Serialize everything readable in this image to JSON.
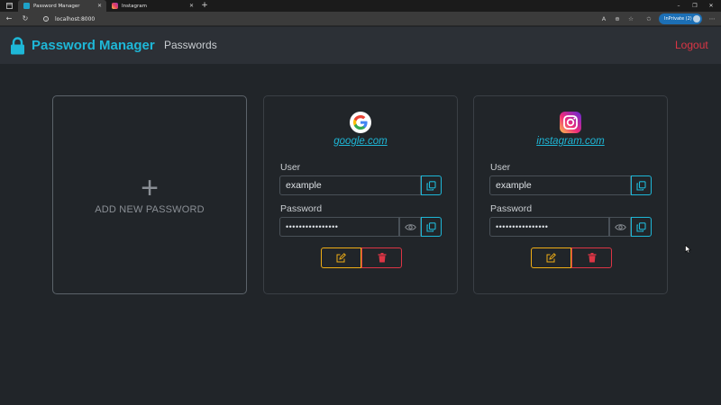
{
  "browser": {
    "tabs": [
      {
        "title": "Password Manager",
        "favicon": "lock-icon",
        "active": true
      },
      {
        "title": "Instagram",
        "favicon": "instagram-icon",
        "active": false
      }
    ],
    "new_tab": "+",
    "url": "localhost:8000",
    "inprivate_label": "InPrivate (2)",
    "window_controls": [
      "–",
      "❐",
      "✕"
    ]
  },
  "navbar": {
    "brand_title": "Password Manager",
    "brand_icon": "lock-icon",
    "link_passwords": "Passwords",
    "logout": "Logout"
  },
  "add_card": {
    "plus": "+",
    "label": "ADD NEW PASSWORD"
  },
  "passwords": [
    {
      "site": "google.com",
      "logo": "google-logo",
      "user_label": "User",
      "user_value": "example",
      "password_label": "Password",
      "password_value": "••••••••••••••••"
    },
    {
      "site": "instagram.com",
      "logo": "instagram-logo",
      "user_label": "User",
      "user_value": "example",
      "password_label": "Password",
      "password_value": "••••••••••••••••"
    }
  ],
  "colors": {
    "accent": "#1eb7d7",
    "danger": "#dc3545",
    "warning": "#f0ad15",
    "background": "#212529",
    "navbar": "#2c3036"
  }
}
